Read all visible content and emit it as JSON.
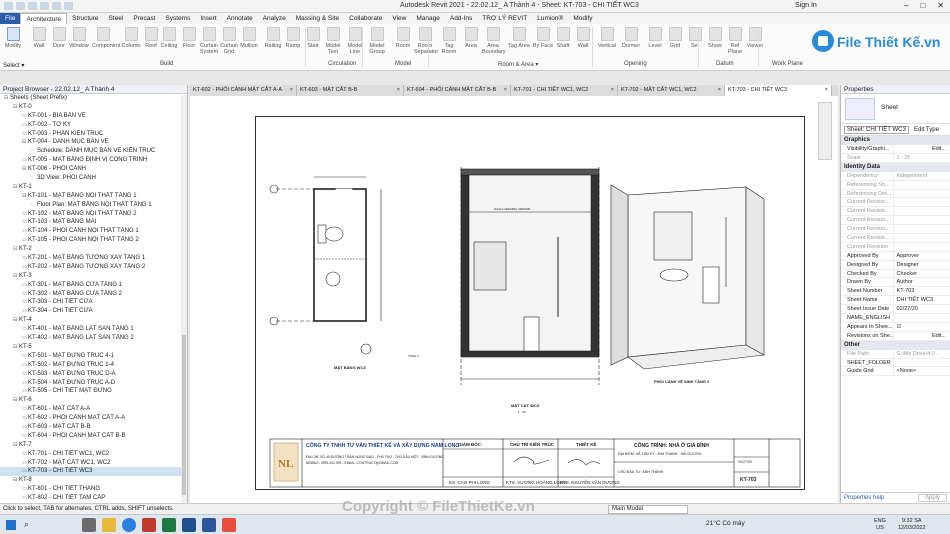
{
  "window": {
    "title": "Autodesk Revit 2021 - 22.02.12_ A Thành 4 - Sheet: KT-703 - CHI TIẾT WC3",
    "sign_in": "Sign In"
  },
  "ribbon_tabs": [
    "File",
    "Architecture",
    "Structure",
    "Steel",
    "Precast",
    "Systems",
    "Insert",
    "Annotate",
    "Analyze",
    "Massing & Site",
    "Collaborate",
    "View",
    "Manage",
    "Add-Ins",
    "TRỢ LÝ REVIT",
    "Lumion®",
    "Modify"
  ],
  "ribbon": {
    "modify": "Modify",
    "select": "Select ▾",
    "buttons": [
      "Wall",
      "Door",
      "Window",
      "Component",
      "Column",
      "Roof",
      "Ceiling",
      "Floor",
      "Curtain System",
      "Curtain Grid",
      "Mullion",
      "Railing",
      "Ramp",
      "Stair",
      "Model Text",
      "Model Line",
      "Model Group",
      "Room",
      "Room Separator",
      "Tag Room",
      "Area",
      "Area Boundary",
      "Tag Area",
      "By Face",
      "Shaft",
      "Wall",
      "Vertical",
      "Dormer",
      "Level",
      "Grid",
      "Set",
      "Show",
      "Ref Plane",
      "Viewer"
    ],
    "panels": [
      "Build",
      "Circulation",
      "Model",
      "Room & Area ▾",
      "Opening",
      "Datum",
      "Work Plane"
    ]
  },
  "logo": {
    "text": "File Thiết Kế.vn"
  },
  "project_browser": {
    "title": "Project Browser - 22.02.12_ A Thành 4",
    "rows": [
      {
        "t": "Sheets (Sheet Prefix)",
        "lvl": 0,
        "exp": "▬"
      },
      {
        "t": "KT-0",
        "lvl": 1,
        "exp": "▬"
      },
      {
        "t": "KT-001 - BÌA BẢN VẼ",
        "lvl": 2
      },
      {
        "t": "KT-002 - TỜ KÝ",
        "lvl": 2
      },
      {
        "t": "KT-003 - PHÂN KIỆN TRÚC",
        "lvl": 2
      },
      {
        "t": "KT-004 - DANH MỤC BẢN VẼ",
        "lvl": 2,
        "exp": "▬"
      },
      {
        "t": "Schedule: DANH MỤC BẢN VẼ KIẾN TRÚC",
        "lvl": 3
      },
      {
        "t": "KT-005 - MẶT BẰNG ĐỊNH VỊ CÔNG TRÌNH",
        "lvl": 2
      },
      {
        "t": "KT-006 - PHỐI CẢNH",
        "lvl": 2,
        "exp": "▬"
      },
      {
        "t": "3D View: PHỐI CẢNH",
        "lvl": 3
      },
      {
        "t": "KT-1",
        "lvl": 1,
        "exp": "▬"
      },
      {
        "t": "KT-101 - MẶT BẰNG NỘI THẤT TẦNG 1",
        "lvl": 2,
        "exp": "▬"
      },
      {
        "t": "Floor Plan: MẶT BẰNG NỘI THẤT TẦNG 1",
        "lvl": 3
      },
      {
        "t": "KT-102 - MẶT BẰNG NỘI THẤT TẦNG 2",
        "lvl": 2
      },
      {
        "t": "KT-103 - MẶT BẰNG MÁI",
        "lvl": 2
      },
      {
        "t": "KT-104 - PHỐI CẢNH NỘI THẤT TẦNG 1",
        "lvl": 2
      },
      {
        "t": "KT-105 - PHỐI CẢNH NỘI THẤT TẦNG 2",
        "lvl": 2
      },
      {
        "t": "KT-2",
        "lvl": 1,
        "exp": "▬"
      },
      {
        "t": "KT-201 - MẶT BẰNG TƯỜNG XÂY TẦNG 1",
        "lvl": 2
      },
      {
        "t": "KT-202 - MẶT BẰNG TƯỜNG XÂY TẦNG 2",
        "lvl": 2
      },
      {
        "t": "KT-3",
        "lvl": 1,
        "exp": "▬"
      },
      {
        "t": "KT-301 - MẶT BẰNG CỬA TẦNG 1",
        "lvl": 2
      },
      {
        "t": "KT-302 - MẶT BẰNG CỬA TẦNG 2",
        "lvl": 2
      },
      {
        "t": "KT-303 - CHI TIẾT CỬA",
        "lvl": 2
      },
      {
        "t": "KT-304 - CHI TIẾT CỬA",
        "lvl": 2
      },
      {
        "t": "KT-4",
        "lvl": 1,
        "exp": "▬"
      },
      {
        "t": "KT-401 - MẶT BẰNG LÁT SÀN TẦNG 1",
        "lvl": 2
      },
      {
        "t": "KT-402 - MẶT BẰNG LÁT SÀN TẦNG 2",
        "lvl": 2
      },
      {
        "t": "KT-5",
        "lvl": 1,
        "exp": "▬"
      },
      {
        "t": "KT-501 - MẶT ĐỨNG TRỤC 4-1",
        "lvl": 2
      },
      {
        "t": "KT-502 - MẶT ĐỨNG TRỤC 1-4",
        "lvl": 2
      },
      {
        "t": "KT-503 - MẶT ĐỨNG TRỤC D-A",
        "lvl": 2
      },
      {
        "t": "KT-504 - MẶT ĐỨNG TRỤC A-D",
        "lvl": 2
      },
      {
        "t": "KT-505 - CHI TIẾT MẶT ĐỨNG",
        "lvl": 2
      },
      {
        "t": "KT-6",
        "lvl": 1,
        "exp": "▬"
      },
      {
        "t": "KT-601 - MẶT CẮT A-A",
        "lvl": 2
      },
      {
        "t": "KT-602 - PHỐI CẢNH MẶT CẮT A-A",
        "lvl": 2
      },
      {
        "t": "KT-603 - MẶT CẮT B-B",
        "lvl": 2
      },
      {
        "t": "KT-604 - PHỐI CẢNH MẶT CẮT B-B",
        "lvl": 2
      },
      {
        "t": "KT-7",
        "lvl": 1,
        "exp": "▬"
      },
      {
        "t": "KT-701 - CHI TIẾT WC1, WC2",
        "lvl": 2
      },
      {
        "t": "KT-702 - MẶT CẮT WC1, WC2",
        "lvl": 2
      },
      {
        "t": "KT-703 - CHI TIẾT WC3",
        "lvl": 2,
        "sel": true
      },
      {
        "t": "KT-8",
        "lvl": 1,
        "exp": "▬"
      },
      {
        "t": "KT-801 - CHI TIẾT THANG",
        "lvl": 2
      },
      {
        "t": "KT-802 - CHI TIẾT TAM CẤP",
        "lvl": 2
      }
    ]
  },
  "doc_tabs": [
    {
      "label": "KT-602 - PHỐI CẢNH MẶT CẮT A-A"
    },
    {
      "label": "KT-603 - MẶT CẮT B-B"
    },
    {
      "label": "KT-604 - PHỐI CẢNH MẶT CẮT B-B"
    },
    {
      "label": "KT-701 - CHI TIẾT WC1, WC2"
    },
    {
      "label": "KT-702 - MẶT CẮT WC1, WC2"
    },
    {
      "label": "KT-703 - CHI TIẾT WC3",
      "active": true
    }
  ],
  "sheet": {
    "plan_title": "MẶT BẰNG WC3",
    "section_title": "MẶT CẮT WC3",
    "persp_title": "PHỐI CẢNH VỆ SINH TẦNG 2",
    "level_label": "TẦNG 2",
    "tile_note": "GẠCH CERAMIC 300X600",
    "scale_note": "1 : 25",
    "title_block": {
      "company": "CÔNG TY TNHH TƯ VẤN THIẾT KẾ VÀ XÂY DỰNG NAM LONG",
      "address": "ĐỊA CHỈ: SỐ 40 ĐƯỜNG TRẦN HƯNG ĐẠO - PHÚ THỌ - THỦ DẦU MỘT - BÌNH DƯƠNG",
      "contact": "MOBILE: 0993.441.393 - EMAIL: CONTRUCT@GMAIL.COM",
      "director_h": "GIÁM ĐỐC",
      "director_n": "KS. CAO PHI LONG",
      "arch_h": "CHỦ TRÌ KIẾN TRÚC",
      "arch_n": "KTS. VƯƠNG HOÀNG LONG",
      "design_h": "THIẾT KẾ",
      "design_n": "KTS. NGUYỄN VĂN DƯƠNG",
      "project": "CÔNG TRÌNH: NHÀ Ở GIA ĐÌNH",
      "location": "ĐỊA ĐIỂM: XÃ TÂN KỲ - KIM THÀNH - HẢI DƯƠNG",
      "owner": "CHỦ ĐẦU TƯ: ANH THÀNH",
      "sheet_no": "KT-703",
      "date": "02/27/20"
    }
  },
  "properties": {
    "title": "Properties",
    "type_name": "Sheet",
    "selector": "Sheet: CHI TIẾT WC3",
    "edit_type": "Edit Type",
    "groups": [
      {
        "name": "Graphics",
        "rows": [
          {
            "k": "Visibility/Graphi...",
            "v": "Edit...",
            "btn": true
          },
          {
            "k": "Scale",
            "v": "1 : 25",
            "gray": true
          }
        ]
      },
      {
        "name": "Identity Data",
        "rows": [
          {
            "k": "Dependency",
            "v": "Independent",
            "gray": true
          },
          {
            "k": "Referencing Sh...",
            "v": "",
            "gray": true
          },
          {
            "k": "Referencing Det...",
            "v": "",
            "gray": true
          },
          {
            "k": "Current Revisio...",
            "v": "",
            "gray": true
          },
          {
            "k": "Current Revisio...",
            "v": "",
            "gray": true
          },
          {
            "k": "Current Revisio...",
            "v": "",
            "gray": true
          },
          {
            "k": "Current Revisio...",
            "v": "",
            "gray": true
          },
          {
            "k": "Current Revisio...",
            "v": "",
            "gray": true
          },
          {
            "k": "Current Revision",
            "v": "",
            "gray": true
          },
          {
            "k": "Approved By",
            "v": "Approver"
          },
          {
            "k": "Designed By",
            "v": "Designer"
          },
          {
            "k": "Checked By",
            "v": "Checker"
          },
          {
            "k": "Drawn By",
            "v": "Author"
          },
          {
            "k": "Sheet Number",
            "v": "KT-703"
          },
          {
            "k": "Sheet Name",
            "v": "CHI TIẾT WC3"
          },
          {
            "k": "Sheet Issue Date",
            "v": "02/27/20"
          },
          {
            "k": "NAME_ENGLISH",
            "v": ""
          },
          {
            "k": "Appears In Shee...",
            "v": "☑"
          },
          {
            "k": "Revisions on She...",
            "v": "Edit...",
            "btn": true
          }
        ]
      },
      {
        "name": "Other",
        "rows": [
          {
            "k": "File Path",
            "v": "G:\\My Drive\\4.0 ...",
            "gray": true
          },
          {
            "k": "SHEET_FOLDER",
            "v": ""
          },
          {
            "k": "Guide Grid",
            "v": "<None>"
          }
        ]
      }
    ],
    "help": "Properties help",
    "apply": "Apply"
  },
  "status": {
    "message": "Click to select, TAB for alternates, CTRL adds, SHIFT unselects.",
    "model": "Main Model"
  },
  "watermark": "Copyright © FileThietKe.vn",
  "taskbar": {
    "search": "⌕",
    "weather": "21°C  Có mây",
    "lang1": "ENG",
    "lang2": "US",
    "time": "9:32 SA",
    "date": "12/03/2022"
  }
}
